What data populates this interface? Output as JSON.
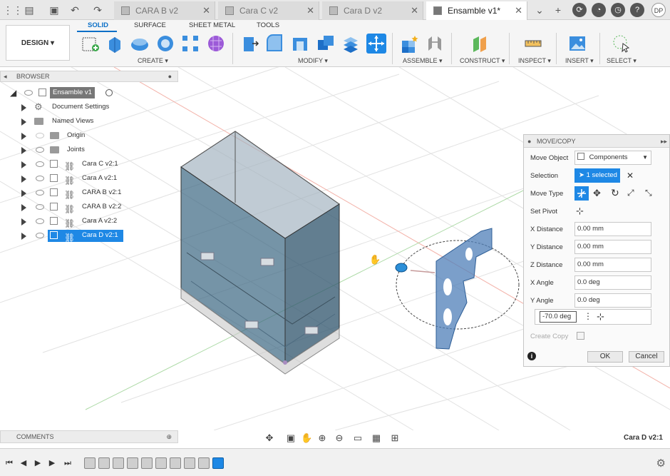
{
  "tabs": [
    {
      "label": "CARA B v2",
      "active": false
    },
    {
      "label": "Cara C v2",
      "active": false
    },
    {
      "label": "Cara D v2",
      "active": false
    },
    {
      "label": "Ensamble v1*",
      "active": true
    }
  ],
  "account": {
    "initials": "DP"
  },
  "workspace": {
    "label": "DESIGN ▾"
  },
  "ribbon": {
    "tabs": [
      "SOLID",
      "SURFACE",
      "SHEET METAL",
      "TOOLS"
    ],
    "groups": [
      "CREATE ▾",
      "MODIFY ▾",
      "ASSEMBLE ▾",
      "CONSTRUCT ▾",
      "INSPECT ▾",
      "INSERT ▾",
      "SELECT ▾"
    ]
  },
  "browser": {
    "title": "BROWSER",
    "root": "Ensamble v1",
    "items": [
      {
        "label": "Document Settings",
        "kind": "settings"
      },
      {
        "label": "Named Views",
        "kind": "folder"
      },
      {
        "label": "Origin",
        "kind": "folder"
      },
      {
        "label": "Joints",
        "kind": "folder"
      },
      {
        "label": "Cara C v2:1",
        "kind": "component"
      },
      {
        "label": "Cara A v2:1",
        "kind": "component"
      },
      {
        "label": "CARA B v2:1",
        "kind": "component"
      },
      {
        "label": "CARA B v2:2",
        "kind": "component"
      },
      {
        "label": "Cara A v2:2",
        "kind": "component"
      },
      {
        "label": "Cara D v2:1",
        "kind": "component",
        "selected": true
      }
    ]
  },
  "dialog": {
    "title": "MOVE/COPY",
    "move_object_label": "Move Object",
    "move_object_value": "Components",
    "selection_label": "Selection",
    "selection_value": "1 selected",
    "move_type_label": "Move Type",
    "set_pivot_label": "Set Pivot",
    "x_distance_label": "X Distance",
    "x_distance_value": "0.00 mm",
    "y_distance_label": "Y Distance",
    "y_distance_value": "0.00 mm",
    "z_distance_label": "Z Distance",
    "z_distance_value": "0.00 mm",
    "x_angle_label": "X Angle",
    "x_angle_value": "0.0 deg",
    "y_angle_label": "Y Angle",
    "y_angle_value": "0.0 deg",
    "z_angle_value": "-70.0 deg",
    "create_copy_label": "Create Copy",
    "ok_label": "OK",
    "cancel_label": "Cancel"
  },
  "comments": {
    "title": "COMMENTS"
  },
  "status": {
    "selection": "Cara D v2:1"
  },
  "colors": {
    "accent": "#1e88e5",
    "ribbon_active": "#0b6fc7",
    "part_blue": "#4f7fb8"
  }
}
